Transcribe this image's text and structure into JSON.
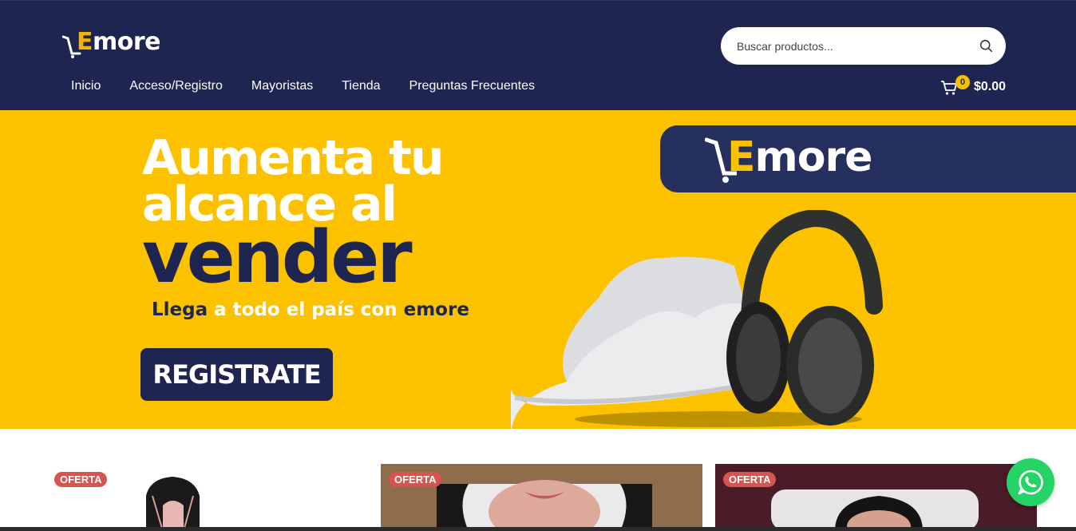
{
  "header": {
    "logo_text_e": "E",
    "logo_text_rest": "more",
    "search": {
      "placeholder": "Buscar productos..."
    },
    "nav": [
      {
        "label": "Inicio"
      },
      {
        "label": "Acceso/Registro"
      },
      {
        "label": "Mayoristas"
      },
      {
        "label": "Tienda"
      },
      {
        "label": "Preguntas Frecuentes"
      }
    ],
    "cart": {
      "count": "0",
      "total": "$0.00"
    }
  },
  "hero": {
    "line1": "Aumenta tu",
    "line2": "alcance al",
    "line3": "vender",
    "sub_part1": "Llega",
    "sub_part2": " a todo el país con ",
    "sub_part3": "emore",
    "button": "REGISTRATE",
    "brand_e": "E",
    "brand_rest": "more"
  },
  "products": [
    {
      "badge": "OFERTA"
    },
    {
      "badge": "OFERTA"
    },
    {
      "badge": "OFERTA"
    }
  ],
  "colors": {
    "navy": "#1e2550",
    "yellow": "#fcc200",
    "sale_red": "#d9534f",
    "whatsapp": "#25d366"
  }
}
